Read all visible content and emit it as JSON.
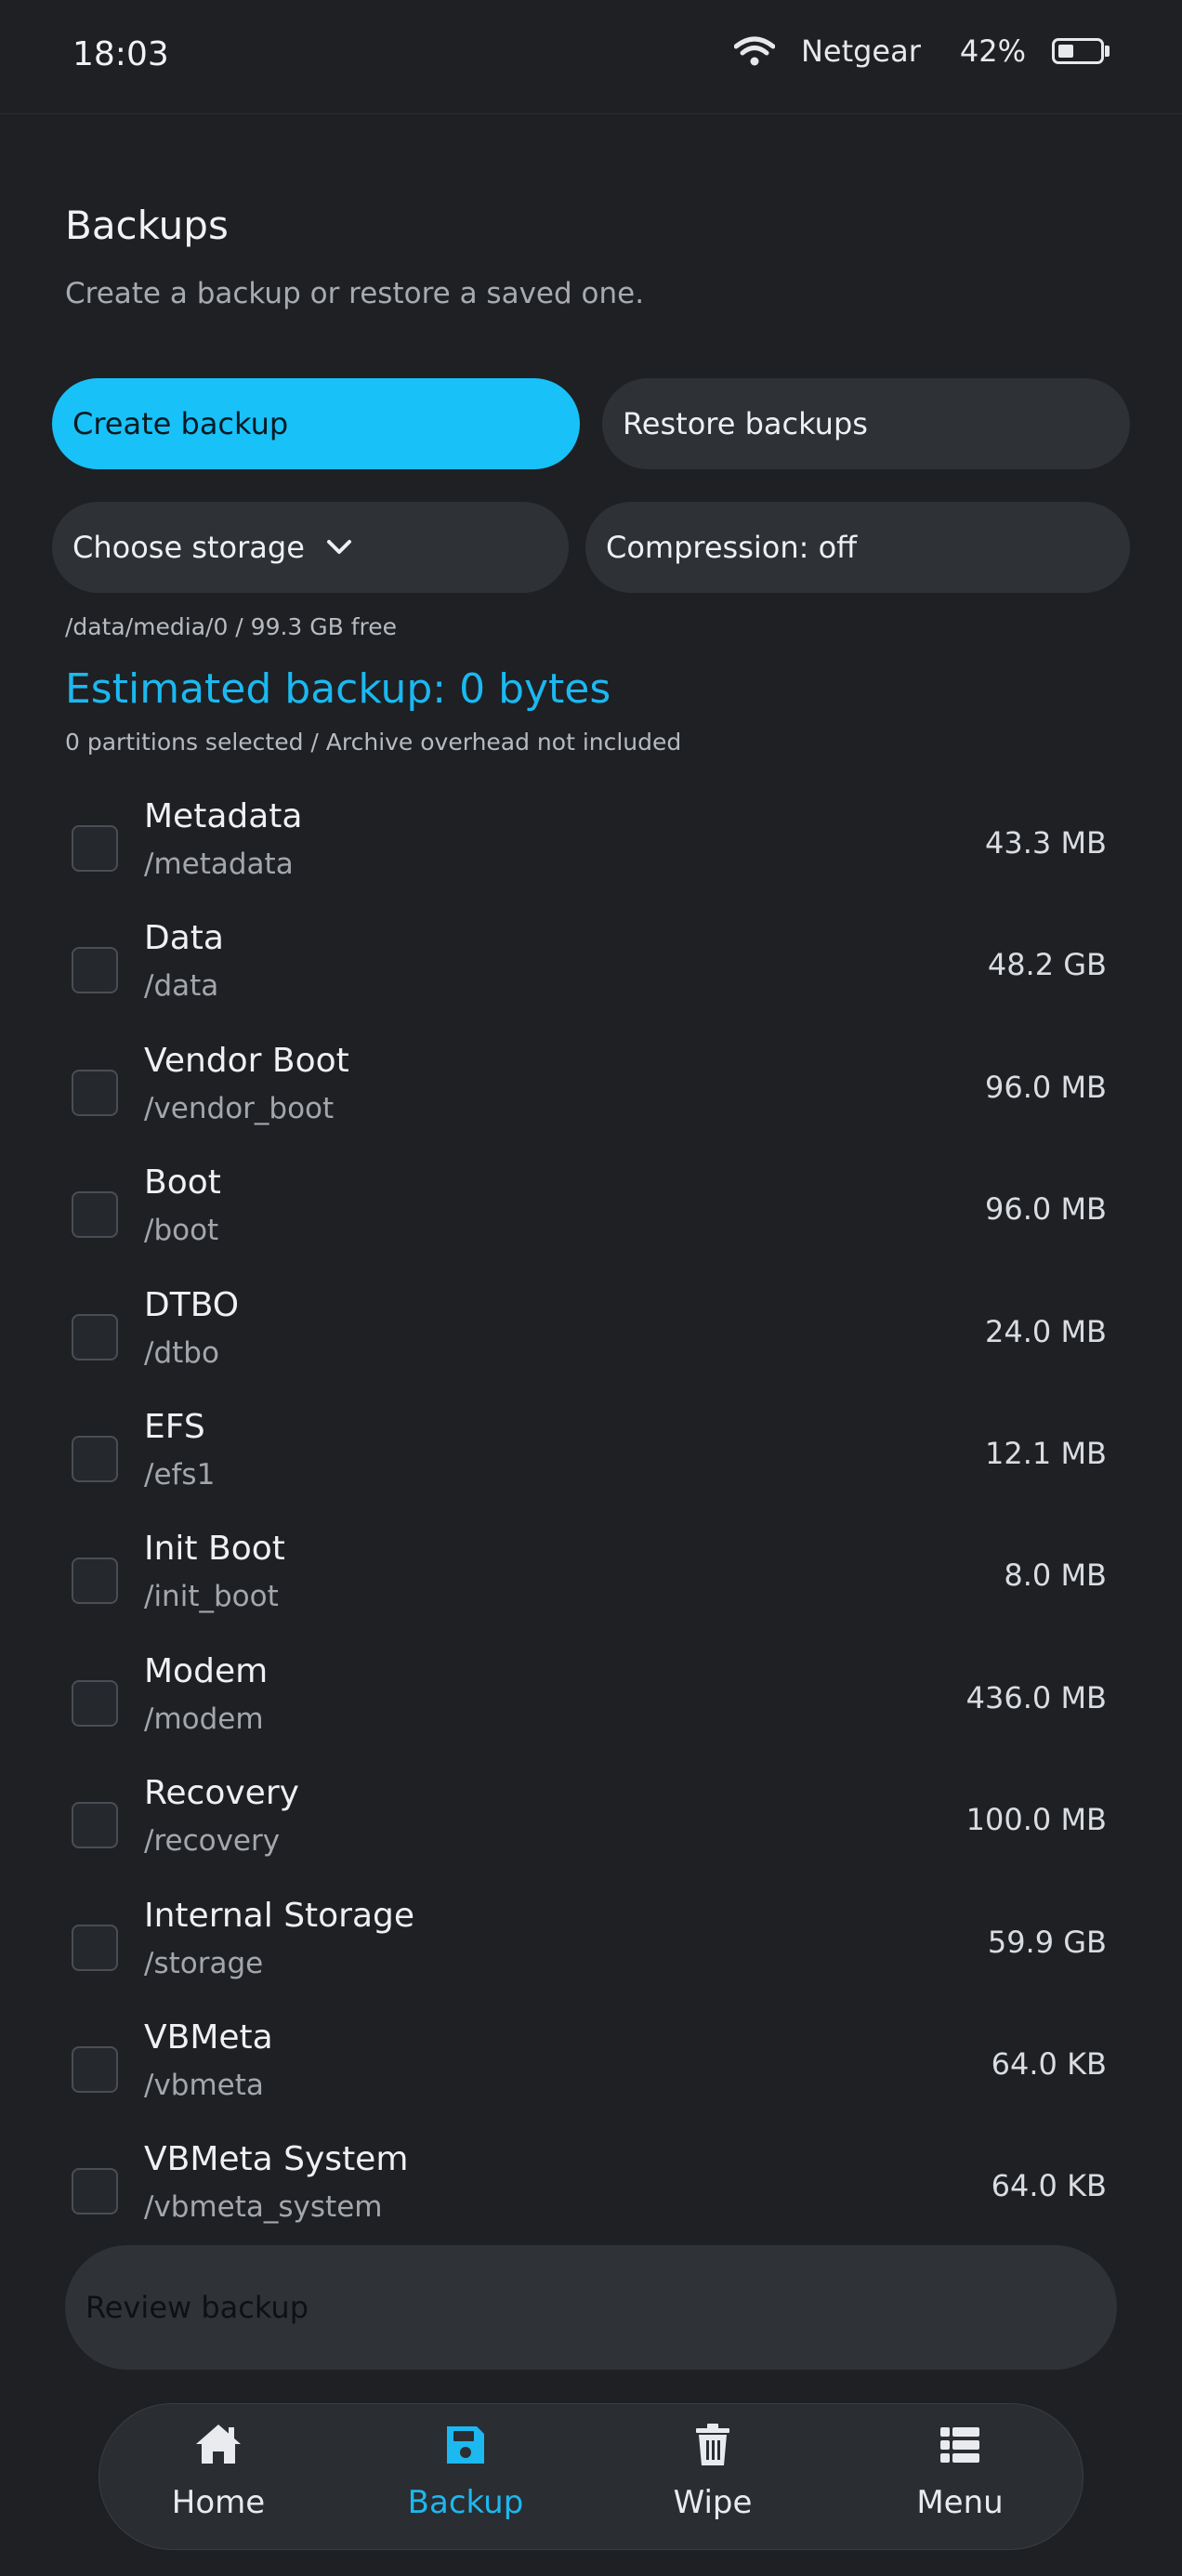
{
  "status": {
    "time": "18:03",
    "network": "Netgear",
    "battery": "42%"
  },
  "page": {
    "title": "Backups",
    "subtitle": "Create a backup or restore a saved one."
  },
  "actions": {
    "create": "Create backup",
    "restore": "Restore backups",
    "storage": "Choose storage",
    "compression": "Compression: off"
  },
  "storage_info": "/data/media/0 / 99.3 GB free",
  "estimate": {
    "title": "Estimated backup: 0 bytes",
    "subtitle": "0 partitions selected / Archive overhead not included"
  },
  "partitions": [
    {
      "name": "Metadata",
      "path": "/metadata",
      "size": "43.3 MB"
    },
    {
      "name": "Data",
      "path": "/data",
      "size": "48.2 GB"
    },
    {
      "name": "Vendor Boot",
      "path": "/vendor_boot",
      "size": "96.0 MB"
    },
    {
      "name": "Boot",
      "path": "/boot",
      "size": "96.0 MB"
    },
    {
      "name": "DTBO",
      "path": "/dtbo",
      "size": "24.0 MB"
    },
    {
      "name": "EFS",
      "path": "/efs1",
      "size": "12.1 MB"
    },
    {
      "name": "Init Boot",
      "path": "/init_boot",
      "size": "8.0 MB"
    },
    {
      "name": "Modem",
      "path": "/modem",
      "size": "436.0 MB"
    },
    {
      "name": "Recovery",
      "path": "/recovery",
      "size": "100.0 MB"
    },
    {
      "name": "Internal Storage",
      "path": "/storage",
      "size": "59.9 GB"
    },
    {
      "name": "VBMeta",
      "path": "/vbmeta",
      "size": "64.0 KB"
    },
    {
      "name": "VBMeta System",
      "path": "/vbmeta_system",
      "size": "64.0 KB"
    }
  ],
  "review_label": "Review backup",
  "nav": [
    {
      "label": "Home",
      "icon": "home-icon"
    },
    {
      "label": "Backup",
      "icon": "save-icon",
      "active": true
    },
    {
      "label": "Wipe",
      "icon": "trash-icon"
    },
    {
      "label": "Menu",
      "icon": "list-icon"
    }
  ],
  "colors": {
    "accent": "#18c1f8",
    "background": "#1e2023",
    "surface": "#2e3136"
  }
}
